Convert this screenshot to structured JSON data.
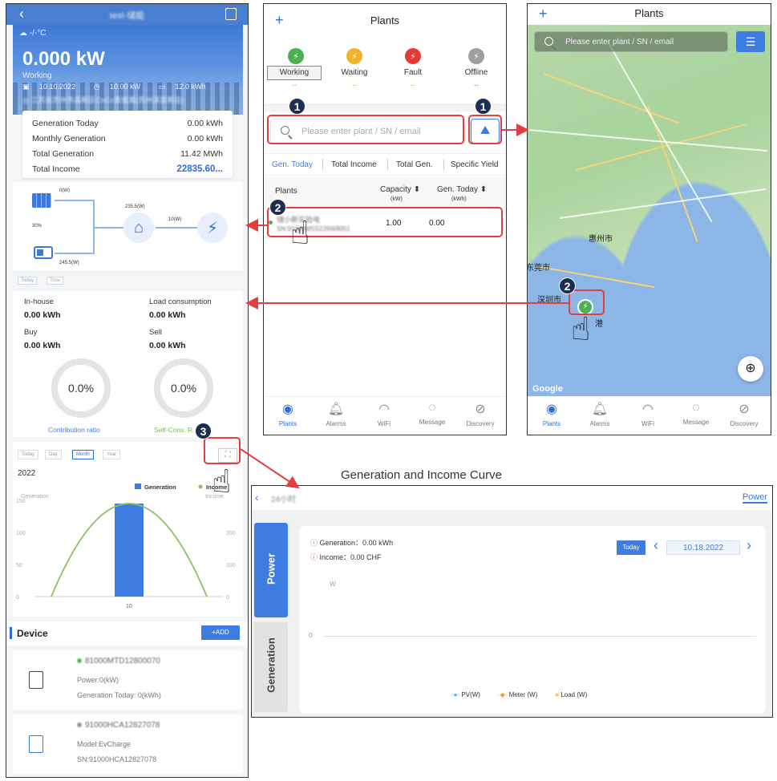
{
  "left": {
    "title": "test-储能",
    "weather": "-/-°C",
    "power": "0.000 kW",
    "status": "Working",
    "date": "10.10.2022",
    "capacity": "10.00 kW",
    "storage": "12.0 kWh",
    "address": "江苏省苏州市高新区CoCo香蜜屋(苏州滨景新店)",
    "summary": [
      {
        "label": "Generation Today",
        "value": "0.00 kWh"
      },
      {
        "label": "Monthly Generation",
        "value": "0.00 kWh"
      },
      {
        "label": "Total Generation",
        "value": "11.42 MWh"
      },
      {
        "label": "Total Income",
        "value": "22835.60..."
      }
    ],
    "flow": {
      "pv": "0(W)",
      "soc": "30%",
      "home": "235.5(W)",
      "grid": "10(W)",
      "battery": "245.5(W)"
    },
    "flow_tabs": [
      "Today",
      "Total"
    ],
    "energy": {
      "inhouse_label": "In-house",
      "inhouse_value": "0.00 kWh",
      "load_label": "Load consumption",
      "load_value": "0.00 kWh",
      "buy_label": "Buy",
      "buy_value": "0.00 kWh",
      "sell_label": "Sell",
      "sell_value": "0.00 kWh",
      "ring1": "0.0%",
      "ring2": "0.0%",
      "ring1_caption": "Contribution ratio",
      "ring2_caption": "Self-Cons. R..."
    },
    "period_tabs": [
      "Today",
      "Day",
      "Month",
      "Year"
    ],
    "device_title": "Device",
    "add_label": "+ADD",
    "devices": [
      {
        "sn": "81000MTD12800070",
        "line1": "Power:0(kW)",
        "line2": "Generation Today: 0(kWh)",
        "status_color": "#5cb85c"
      },
      {
        "sn": "91000HCA12827078",
        "line1": "Model:EvCharge",
        "line2": "SN:91000HCA12827078",
        "status_color": "#999999"
      }
    ]
  },
  "chart_data": {
    "type": "bar",
    "title": "2022",
    "series": [
      {
        "name": "Generation",
        "values": [
          145
        ]
      },
      {
        "name": "Income",
        "values": [
          145
        ]
      }
    ],
    "categories": [
      "10"
    ],
    "ylabel": "Generation",
    "ylabel_right": "Income",
    "ylim": [
      0,
      150
    ],
    "y_ticks_left": [
      "150",
      "100",
      "50",
      "0"
    ],
    "y_ticks_right": [
      "200",
      "100",
      "0"
    ],
    "legend_position": "top-right"
  },
  "mid": {
    "title": "Plants",
    "plus": "+",
    "statuses": [
      {
        "label": "Working",
        "color": "#4caf50",
        "count": "--"
      },
      {
        "label": "Waiting",
        "color": "#f0b429",
        "count": "--"
      },
      {
        "label": "Fault",
        "color": "#e53935",
        "count": "--"
      },
      {
        "label": "Offline",
        "color": "#9e9e9e",
        "count": "--"
      }
    ],
    "search_placeholder": "Please enter plant / SN / email",
    "sort_tabs": [
      "Gen. Today",
      "Total Income",
      "Total Gen.",
      "Specific Yield"
    ],
    "col_plants": "Plants",
    "col_capacity": "Capacity",
    "col_capacity_unit": "(kW)",
    "col_gen": "Gen. Today",
    "col_gen_unit": "(kWh)",
    "row": {
      "name": "储小新实验电",
      "sn": "SN:91000MSS226W8001",
      "capacity": "1.00",
      "gen": "0.00"
    }
  },
  "nav": [
    "Plants",
    "Alarms",
    "WiFi",
    "Message",
    "Discovery"
  ],
  "right": {
    "title": "Plants",
    "plus": "+",
    "search_placeholder": "Please enter plant / SN / email",
    "cities": [
      "惠州市",
      "东莞市",
      "深圳市",
      "港"
    ],
    "google": "Google"
  },
  "bottom": {
    "caption": "Generation and Income Curve",
    "title": "24小时",
    "power_link": "Power",
    "side_tabs": [
      "Power",
      "Generation"
    ],
    "generation_text": "Generation：0.00 kWh",
    "income_text": "Income：0.00 CHF",
    "today_btn": "Today",
    "date": "10.18.2022",
    "unit": "W",
    "zero": "0",
    "legend": [
      {
        "name": "PV(W)",
        "color": "#5aa8e6"
      },
      {
        "name": "Meter (W)",
        "color": "#f0a030"
      },
      {
        "name": "Load (W)",
        "color": "#f0d040"
      }
    ]
  },
  "markers": [
    "1",
    "1",
    "2",
    "2",
    "3"
  ]
}
